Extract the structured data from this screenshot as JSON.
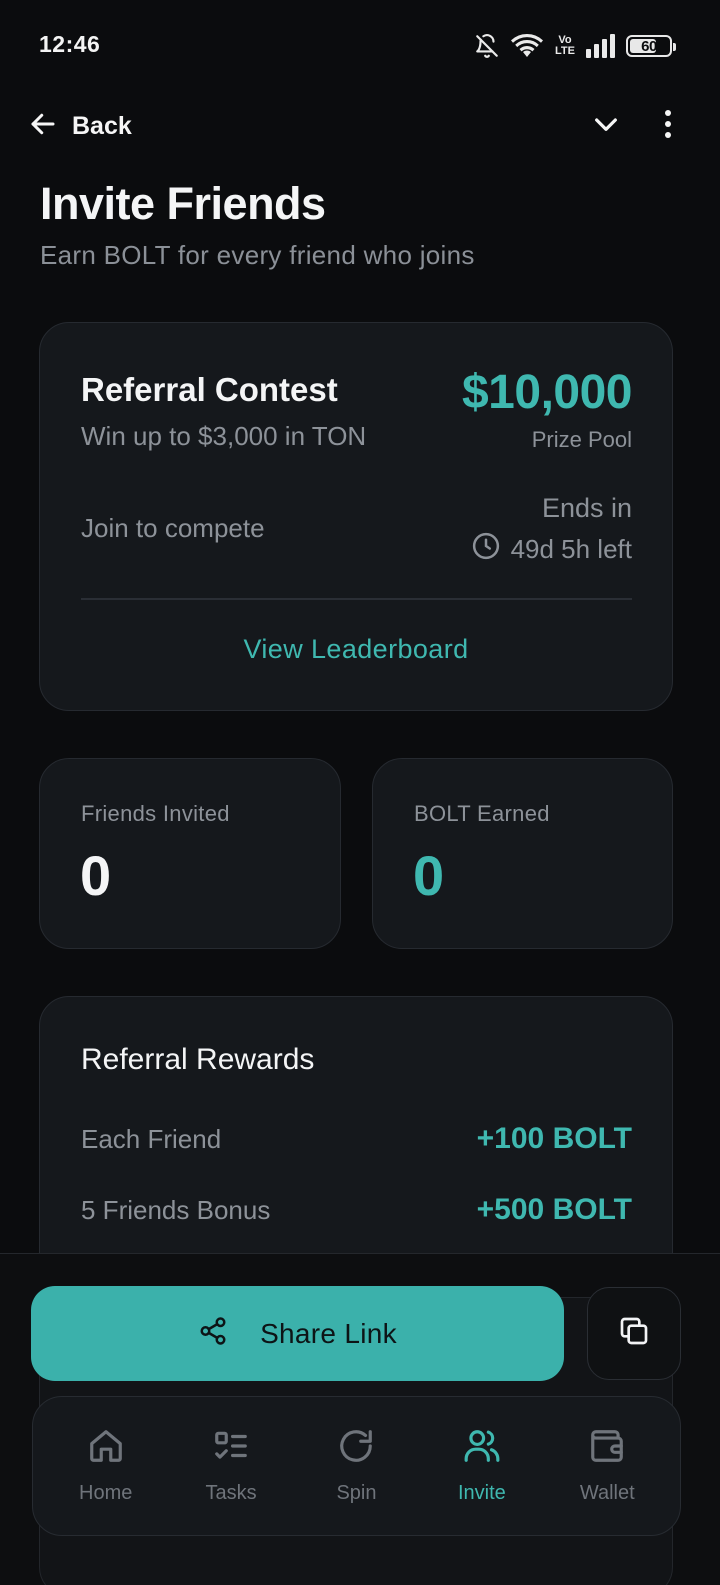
{
  "status_bar": {
    "time": "12:46",
    "battery": "60",
    "network": "Vo LTE"
  },
  "topbar": {
    "back_label": "Back"
  },
  "header": {
    "title": "Invite Friends",
    "subtitle": "Earn BOLT for every friend who joins"
  },
  "contest": {
    "title": "Referral Contest",
    "subtitle": "Win up to $3,000 in TON",
    "prize_amount": "$10,000",
    "prize_label": "Prize Pool",
    "join_text": "Join to compete",
    "ends_label": "Ends in",
    "ends_time": "49d 5h left",
    "leaderboard_label": "View Leaderboard"
  },
  "stats": {
    "friends_label": "Friends Invited",
    "friends_value": "0",
    "bolt_label": "BOLT Earned",
    "bolt_value": "0"
  },
  "rewards": {
    "title": "Referral Rewards",
    "items": [
      {
        "label": "Each Friend",
        "value": "+100 BOLT"
      },
      {
        "label": "5 Friends Bonus",
        "value": "+500 BOLT"
      }
    ]
  },
  "actions": {
    "share_label": "Share Link"
  },
  "nav": {
    "items": [
      {
        "label": "Home",
        "icon": "home-icon"
      },
      {
        "label": "Tasks",
        "icon": "tasks-icon"
      },
      {
        "label": "Spin",
        "icon": "spin-icon"
      },
      {
        "label": "Invite",
        "icon": "invite-icon",
        "active": true
      },
      {
        "label": "Wallet",
        "icon": "wallet-icon"
      }
    ]
  },
  "colors": {
    "accent": "#3fb8b0",
    "background": "#0b0c0e",
    "card": "#15181c",
    "muted_text": "#8d9299"
  }
}
